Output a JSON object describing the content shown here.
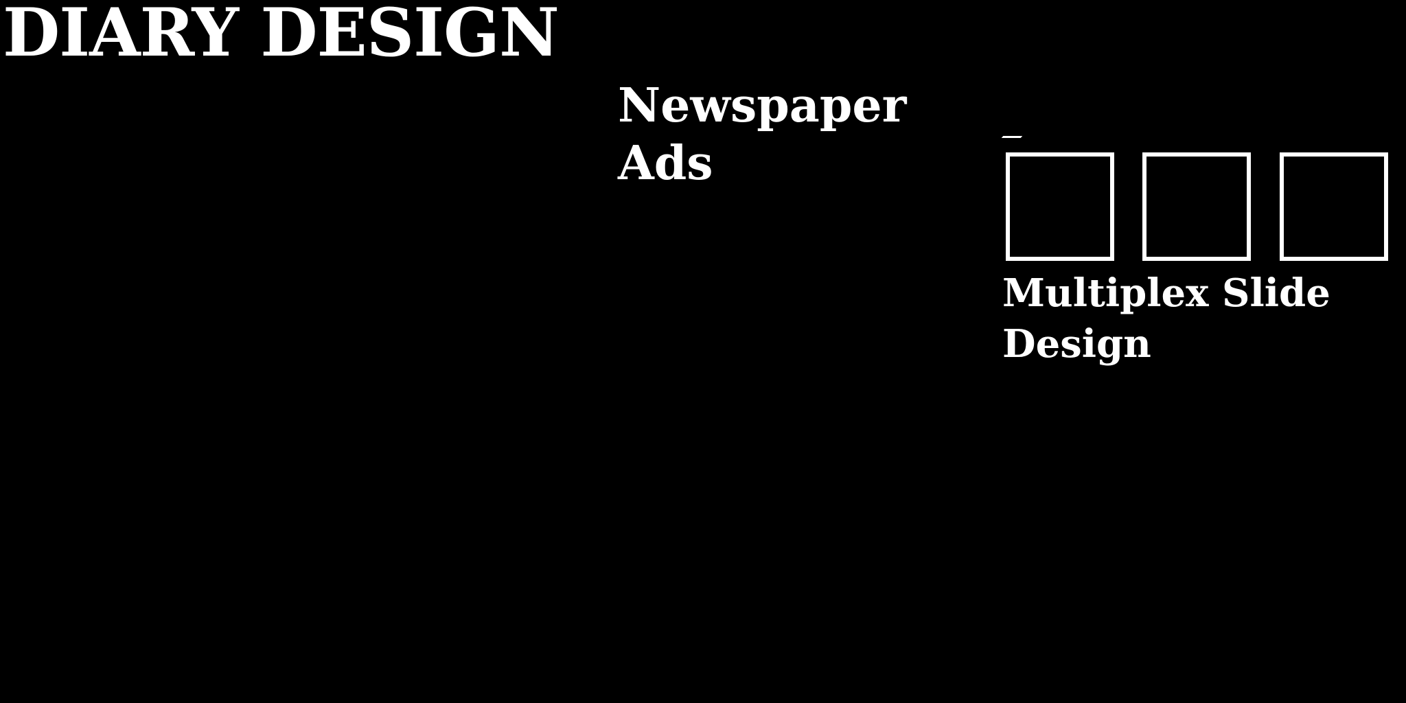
{
  "title": "DIARY DESIGN",
  "newspaper": {
    "line1": "Newspaper",
    "line2": "Ads"
  },
  "multiplex": {
    "line1": "Multiplex Slide",
    "line2": "Design"
  },
  "colors": {
    "background": "#000000",
    "foreground": "#ffffff"
  }
}
